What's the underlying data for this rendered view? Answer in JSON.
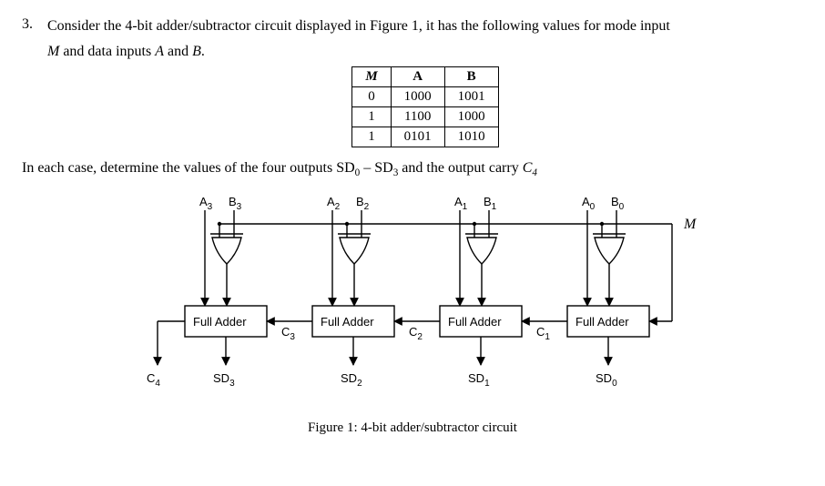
{
  "question_number": "3.",
  "question_text_1": "Consider the 4-bit adder/subtractor circuit displayed in Figure 1, it has the following values for mode input",
  "question_text_2a": "M",
  "question_text_2b": " and data inputs ",
  "question_text_2c": "A",
  "question_text_2d": " and ",
  "question_text_2e": "B",
  "question_text_2f": ".",
  "table": {
    "head": {
      "m": "M",
      "a": "A",
      "b": "B"
    },
    "rows": [
      {
        "m": "0",
        "a": "1000",
        "b": "1001"
      },
      {
        "m": "1",
        "a": "1100",
        "b": "1000"
      },
      {
        "m": "1",
        "a": "0101",
        "b": "1010"
      }
    ]
  },
  "subtext_a": "In each case, determine the values of the four outputs SD",
  "subtext_b": "0",
  "subtext_c": " – SD",
  "subtext_d": "3",
  "subtext_e": " and the output carry ",
  "subtext_f": "C",
  "subtext_g": "4",
  "fig": {
    "a3": "A",
    "a3s": "3",
    "b3": "B",
    "b3s": "3",
    "a2": "A",
    "a2s": "2",
    "b2": "B",
    "b2s": "2",
    "a1": "A",
    "a1s": "1",
    "b1": "B",
    "b1s": "1",
    "a0": "A",
    "a0s": "0",
    "b0": "B",
    "b0s": "0",
    "m": "M",
    "fa": "Full Adder",
    "c4": "C",
    "c4s": "4",
    "c3": "C",
    "c3s": "3",
    "c2": "C",
    "c2s": "2",
    "c1": "C",
    "c1s": "1",
    "sd3": "SD",
    "sd3s": "3",
    "sd2": "SD",
    "sd2s": "2",
    "sd1": "SD",
    "sd1s": "1",
    "sd0": "SD",
    "sd0s": "0",
    "caption": "Figure 1: 4-bit adder/subtractor circuit"
  }
}
